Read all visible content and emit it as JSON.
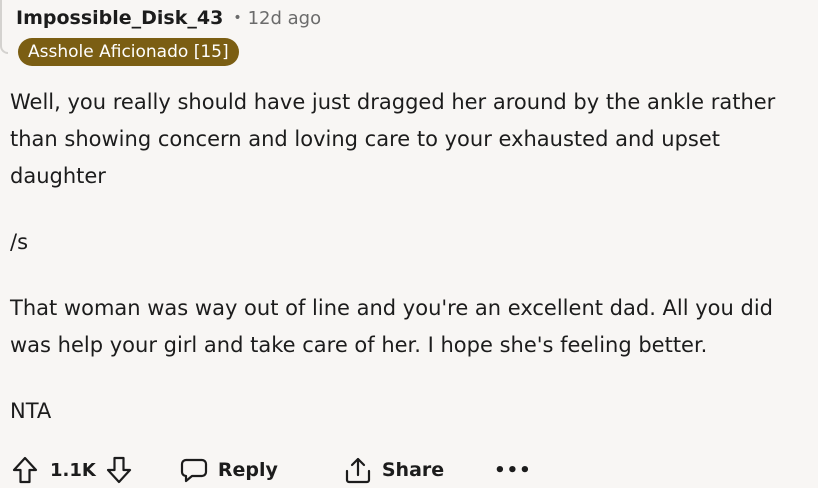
{
  "comment": {
    "username": "Impossible_Disk_43",
    "separator": "•",
    "timestamp": "12d ago",
    "flair": "Asshole Aficionado [15]",
    "paragraphs": [
      "Well, you really should have just dragged her around by the ankle rather than showing concern and loving care to your exhausted and upset daughter",
      "/s",
      "That woman was way out of line and you're an excellent dad. All you did was help your girl and take care of her. I hope she's feeling better.",
      "NTA"
    ]
  },
  "actions": {
    "upvote_icon": "upvote-arrow-icon",
    "vote_count": "1.1K",
    "downvote_icon": "downvote-arrow-icon",
    "reply_icon": "speech-bubble-icon",
    "reply_label": "Reply",
    "share_icon": "share-arrow-icon",
    "share_label": "Share",
    "more_label": "•••"
  },
  "colors": {
    "background": "#f8f6f4",
    "text": "#1c1c1c",
    "muted": "#6b6b6b",
    "flair_bg": "#7b5e13",
    "flair_text": "#ffffff"
  }
}
